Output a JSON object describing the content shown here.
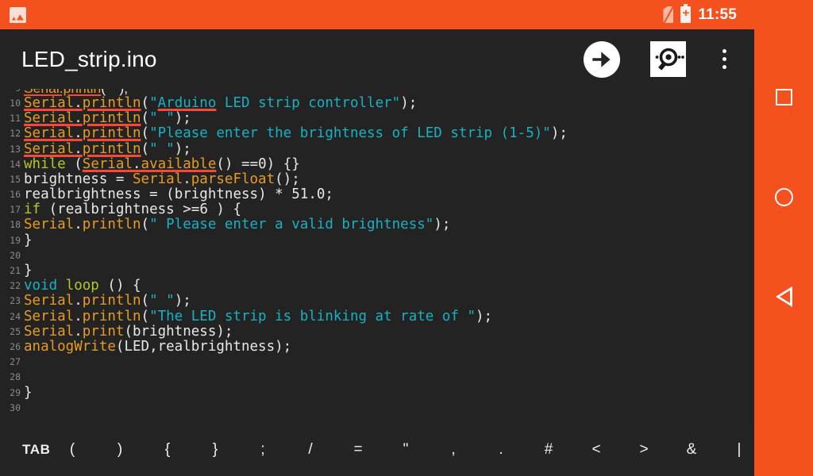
{
  "status_bar": {
    "background": "#f4511e",
    "notification_icon": "gallery-icon",
    "sim_icon": "no-sim-icon",
    "battery_icon": "battery-charging-icon",
    "time": "11:55"
  },
  "app_bar": {
    "background": "#242424",
    "title": "LED_strip.ino",
    "actions": [
      {
        "name": "upload-button",
        "icon": "arrow-right-icon",
        "label": "Upload"
      },
      {
        "name": "serial-monitor-button",
        "icon": "serial-monitor-icon",
        "label": "Serial Monitor"
      },
      {
        "name": "overflow-menu-button",
        "icon": "more-vertical-icon",
        "label": "More options"
      }
    ]
  },
  "editor": {
    "background": "#232323",
    "gutter_color": "#8a8a8a",
    "error_underline_color": "#f4483c",
    "keyword_color": "#b6c62b",
    "type_color": "#15b2c4",
    "function_color": "#e89c20",
    "string_color": "#15b2c4",
    "text_color": "#e8e8e8",
    "clipped_top_line_number": "9",
    "lines": [
      {
        "num": "10",
        "text": "Serial.println(\"Arduino LED strip controller\");"
      },
      {
        "num": "11",
        "text": "Serial.println(\" \");"
      },
      {
        "num": "12",
        "text": "Serial.println(\"Please enter the brightness of LED strip (1-5)\");"
      },
      {
        "num": "13",
        "text": "Serial.println(\" \");"
      },
      {
        "num": "14",
        "text": "while (Serial.available() ==0) {}"
      },
      {
        "num": "15",
        "text": "brightness = Serial.parseFloat();"
      },
      {
        "num": "16",
        "text": "realbrightness = (brightness) * 51.0;"
      },
      {
        "num": "17",
        "text": "if (realbrightness >=6 ) {"
      },
      {
        "num": "18",
        "text": "Serial.println(\" Please enter a valid brightness\");"
      },
      {
        "num": "19",
        "text": "}"
      },
      {
        "num": "20",
        "text": ""
      },
      {
        "num": "21",
        "text": "}"
      },
      {
        "num": "22",
        "text": "void loop () {"
      },
      {
        "num": "23",
        "text": "Serial.println(\" \");"
      },
      {
        "num": "24",
        "text": "Serial.println(\"The LED strip is blinking at rate of \");"
      },
      {
        "num": "25",
        "text": "Serial.print(brightness);"
      },
      {
        "num": "26",
        "text": "analogWrite(LED,realbrightness);"
      },
      {
        "num": "27",
        "text": ""
      },
      {
        "num": "28",
        "text": ""
      },
      {
        "num": "29",
        "text": "}"
      },
      {
        "num": "30",
        "text": ""
      }
    ]
  },
  "symbol_toolbar": {
    "background": "#242424",
    "keys": [
      "TAB",
      "(",
      ")",
      "{",
      "}",
      ";",
      "/",
      "=",
      "\"",
      ",",
      ".",
      "#",
      "<",
      ">",
      "&",
      "|"
    ]
  },
  "nav_bar": {
    "background": "#f4511e",
    "buttons": [
      {
        "name": "recents-button",
        "icon": "square-icon"
      },
      {
        "name": "home-button",
        "icon": "circle-icon"
      },
      {
        "name": "back-button",
        "icon": "triangle-left-icon"
      }
    ]
  }
}
